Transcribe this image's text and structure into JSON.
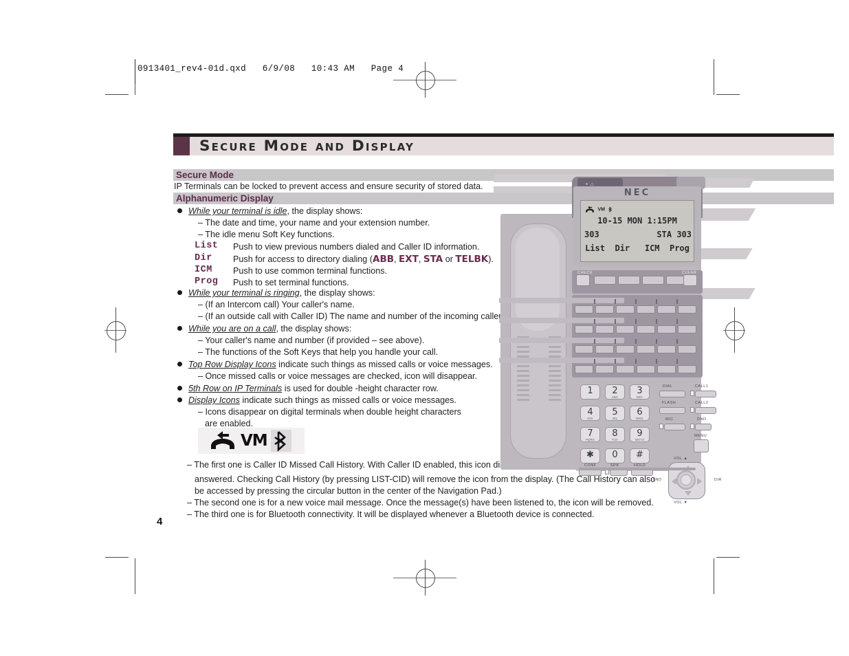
{
  "print_slug": "0913401_rev4-01d.qxd   6/9/08   10:43 AM   Page 4",
  "page_number": "4",
  "header": {
    "title": "Secure Mode and Display",
    "accent_color": "#5b3448",
    "band_color": "#e5dcdd"
  },
  "sections": [
    {
      "band": "Secure Mode",
      "intro": "IP Terminals can be locked to prevent access and ensure security of stored data."
    },
    {
      "band": "Alphanumeric Display"
    }
  ],
  "bullets": [
    {
      "lead": "While your terminal is idle",
      "rest": ", the display shows:",
      "subs": [
        "– The date and time, your name and your extension number.",
        "– The idle menu Soft Key functions."
      ]
    },
    {
      "lead": "While your terminal is ringing",
      "rest": ", the display shows:",
      "subs": [
        "– (If an Intercom call) Your caller's name.",
        "– (If an outside call with Caller ID) The name and number of the incoming caller."
      ]
    },
    {
      "lead": "While you are on a call",
      "rest": ", the display shows:",
      "subs": [
        "– Your caller's name and number (if provided – see above).",
        "– The functions of the Soft Keys that help you handle your call."
      ]
    },
    {
      "lead": "Top Row Display Icons",
      "rest": " indicate such things as missed calls or voice messages.",
      "subs": [
        "– Once missed calls or voice messages are checked, icon will disappear."
      ]
    },
    {
      "lead": "5th Row on IP Terminals",
      "rest": " is used for double -height character row.",
      "subs": []
    },
    {
      "lead": "Display Icons",
      "rest": " indicate such things as missed calls or voice messages.",
      "subs": [
        "– Icons disappear on digital terminals when double height characters",
        "are enabled."
      ]
    }
  ],
  "softkey_table": [
    {
      "key": "List",
      "desc": "Push to view previous numbers dialed and Caller ID information."
    },
    {
      "key": "Dir",
      "desc_pre": "Push for access to directory dialing (",
      "opts": [
        "ABB",
        "EXT",
        "STA"
      ],
      "opt_sep": ", ",
      "opt_or": " or ",
      "opt_last": "TELBK",
      "desc_post": ")."
    },
    {
      "key": "ICM",
      "desc": "Push to use common terminal functions."
    },
    {
      "key": "Prog",
      "desc": "Push to set terminal functions."
    }
  ],
  "softkey_color": "#6b2b4e",
  "display_icons": {
    "missed_call": "missed-call-icon",
    "voicemail": "VM",
    "bluetooth": "bluetooth-icon"
  },
  "icon_notes": [
    "– The first one is Caller ID Missed Call History. With Caller ID enabled, this icon displays when an outside call is not",
    "answered. Checking Call History (by pressing LIST-CID) will remove the icon from the display. (The Call History can also",
    "be accessed by pressing the circular button in the center of the Navigation Pad.)",
    "– The second one is for a new voice mail message. Once the message(s) have been listened to, the icon will be removed.",
    "– The third one is for Bluetooth connectivity. It will be displayed whenever a Bluetooth device is connected."
  ],
  "phone": {
    "brand": "NEC",
    "lcd": {
      "time_line": "10-15 MON  1:15PM",
      "extension": "303",
      "station": "STA 303",
      "softkeys": [
        "List",
        "Dir",
        "ICM",
        "Prog"
      ]
    },
    "softkey_strip": {
      "left_label": "CHECK",
      "right_label": "CLEAR"
    },
    "keypad": [
      {
        "num": "1",
        "sub": ""
      },
      {
        "num": "2",
        "sub": "ABC"
      },
      {
        "num": "3",
        "sub": "DEF"
      },
      {
        "num": "4",
        "sub": "GHI"
      },
      {
        "num": "5",
        "sub": "JKL"
      },
      {
        "num": "6",
        "sub": "MNO"
      },
      {
        "num": "7",
        "sub": "PQRS"
      },
      {
        "num": "8",
        "sub": "TUV"
      },
      {
        "num": "9",
        "sub": "WXYZ"
      },
      {
        "num": "✱",
        "sub": ""
      },
      {
        "num": "0",
        "sub": ""
      },
      {
        "num": "#",
        "sub": ""
      }
    ],
    "bottom_keys": [
      "CONF",
      "SPK",
      "HOLD"
    ],
    "function_keys": [
      "DIAL",
      "CALL1",
      "FLASH",
      "CALL2",
      "MIC",
      "DND"
    ],
    "menu_key": "MENU",
    "nav_labels": {
      "up": "VOL ▲",
      "down": "VOL ▼",
      "left": "LND",
      "right": "DIR"
    }
  }
}
